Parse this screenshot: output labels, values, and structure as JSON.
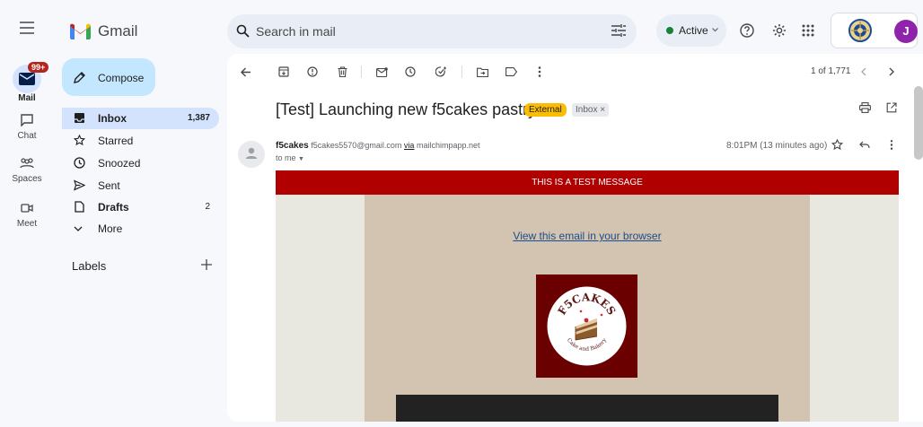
{
  "app": {
    "name": "Gmail"
  },
  "rail": [
    {
      "label": "Mail",
      "badge": "99+",
      "active": true
    },
    {
      "label": "Chat"
    },
    {
      "label": "Spaces"
    },
    {
      "label": "Meet"
    }
  ],
  "search": {
    "placeholder": "Search in mail"
  },
  "status": {
    "label": "Active"
  },
  "account": {
    "initial": "J"
  },
  "compose": {
    "label": "Compose"
  },
  "nav": [
    {
      "label": "Inbox",
      "count": "1,387",
      "active": true,
      "bold": true,
      "icon": "inbox-icon"
    },
    {
      "label": "Starred",
      "count": "",
      "icon": "star-icon"
    },
    {
      "label": "Snoozed",
      "count": "",
      "icon": "clock-icon"
    },
    {
      "label": "Sent",
      "count": "",
      "icon": "send-icon"
    },
    {
      "label": "Drafts",
      "count": "2",
      "bold": true,
      "icon": "draft-icon"
    },
    {
      "label": "More",
      "count": "",
      "icon": "chevron-down-icon"
    }
  ],
  "labels": {
    "title": "Labels"
  },
  "pager": {
    "text": "1 of 1,771"
  },
  "email": {
    "subject": "[Test] Launching new f5cakes pastry",
    "tags": {
      "external": "External",
      "inbox": "Inbox ×"
    },
    "sender_name": "f5cakes",
    "sender_email": "f5cakes5570@gmail.com",
    "via_word": "via",
    "via_domain": "mailchimpapp.net",
    "to": "to me",
    "time": "8:01PM (13 minutes ago)",
    "banner": "THIS IS A TEST MESSAGE",
    "browser_link": "View this email in your browser",
    "logo_title": "F5CAKES",
    "logo_subtitle": "Cake and Bakery"
  },
  "colors": {
    "accent": "#0b57d0",
    "banner": "#b00000",
    "tan": "#d3c4b1",
    "external_tag": "#fbbc04"
  }
}
